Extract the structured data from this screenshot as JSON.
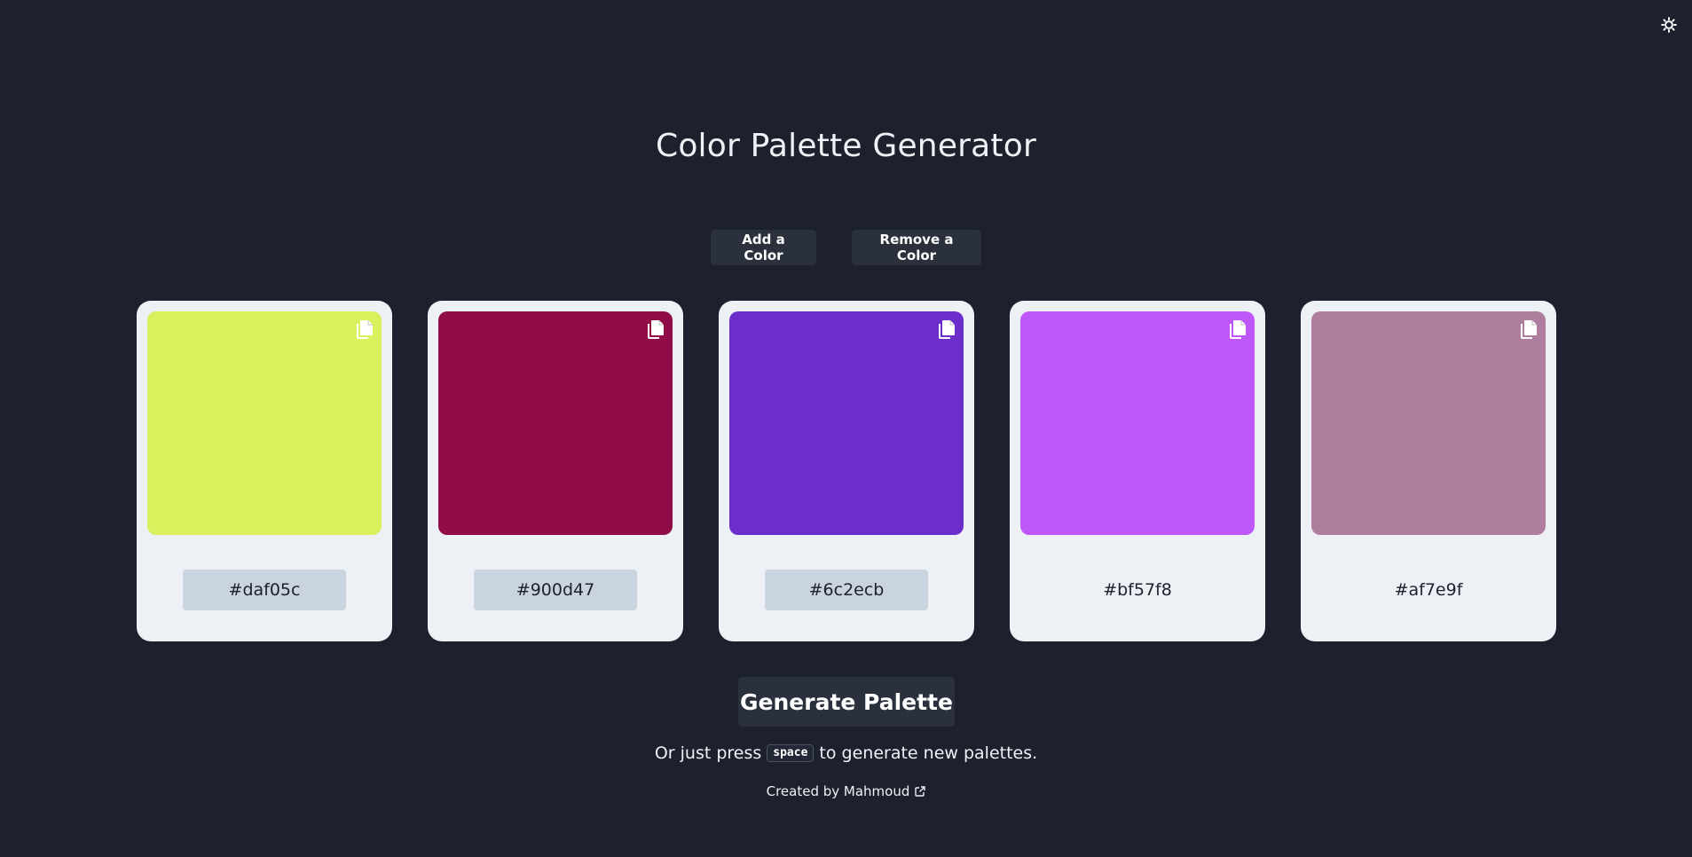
{
  "header": {
    "title": "Color Palette Generator",
    "theme_toggle_icon": "sun-icon"
  },
  "controls": {
    "add_label": "Add a Color",
    "remove_label": "Remove a Color"
  },
  "palette": [
    {
      "hex": "#daf05c",
      "color": "#daf05c",
      "copy_icon": "copy-icon"
    },
    {
      "hex": "#900d47",
      "color": "#900d47",
      "copy_icon": "copy-icon"
    },
    {
      "hex": "#6c2ecb",
      "color": "#6c2ecb",
      "copy_icon": "copy-icon"
    },
    {
      "hex": "#bf57f8",
      "color": "#bf57f8",
      "copy_icon": "copy-icon"
    },
    {
      "hex": "#af7e9f",
      "color": "#af7e9f",
      "copy_icon": "copy-icon"
    }
  ],
  "generate": {
    "label": "Generate Palette"
  },
  "hint": {
    "before": "Or just press",
    "key": "space",
    "after": "to generate new palettes."
  },
  "footer": {
    "credit": "Created by Mahmoud",
    "link_icon": "external-link-icon"
  },
  "colors": {
    "background": "#1c212d",
    "button_bg": "#2b303d",
    "card_bg": "#edf1f6",
    "hex_box_bg": "#cad4de"
  }
}
